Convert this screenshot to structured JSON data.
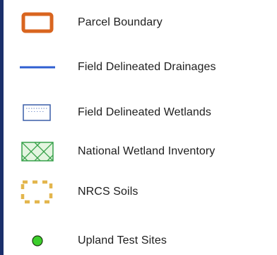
{
  "legend": {
    "items": [
      {
        "label": "Parcel Boundary",
        "icon": "parcel-boundary-swatch-icon",
        "color": "#d9651f"
      },
      {
        "label": "Field Delineated Drainages",
        "icon": "drainage-line-icon",
        "color": "#2f5fd1"
      },
      {
        "label": "Field Delineated Wetlands",
        "icon": "wetland-dotted-box-icon",
        "color": "#3a5ea8"
      },
      {
        "label": "National Wetland Inventory",
        "icon": "nwi-crosshatch-icon",
        "color": "#37a14a"
      },
      {
        "label": "NRCS Soils",
        "icon": "nrcs-soils-dashed-box-icon",
        "color": "#e3b64d"
      },
      {
        "label": "Upland Test Sites",
        "icon": "upland-test-site-dot-icon",
        "color": "#3ccf2c"
      }
    ]
  }
}
